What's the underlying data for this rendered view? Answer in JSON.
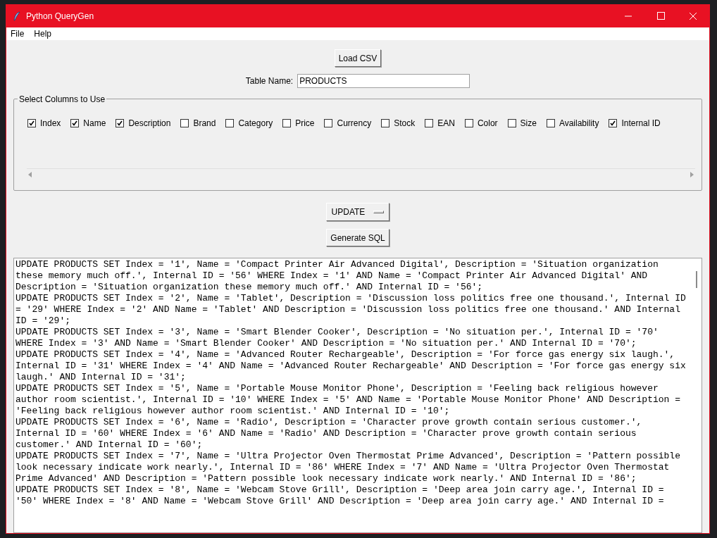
{
  "window": {
    "title": "Python QueryGen"
  },
  "menu": [
    "File",
    "Help"
  ],
  "load_button": "Load CSV",
  "table_name": {
    "label": "Table Name:",
    "value": "PRODUCTS"
  },
  "columns_frame": {
    "title": "Select Columns to Use",
    "columns": [
      {
        "label": "Index",
        "checked": true
      },
      {
        "label": "Name",
        "checked": true
      },
      {
        "label": "Description",
        "checked": true
      },
      {
        "label": "Brand",
        "checked": false
      },
      {
        "label": "Category",
        "checked": false
      },
      {
        "label": "Price",
        "checked": false
      },
      {
        "label": "Currency",
        "checked": false
      },
      {
        "label": "Stock",
        "checked": false
      },
      {
        "label": "EAN",
        "checked": false
      },
      {
        "label": "Color",
        "checked": false
      },
      {
        "label": "Size",
        "checked": false
      },
      {
        "label": "Availability",
        "checked": false
      },
      {
        "label": "Internal ID",
        "checked": true
      }
    ]
  },
  "query_type": "UPDATE",
  "generate_button": "Generate SQL",
  "output": [
    "UPDATE PRODUCTS SET Index = '1', Name = 'Compact Printer Air Advanced Digital', Description = 'Situation organization these memory much off.', Internal ID = '56' WHERE Index = '1' AND Name = 'Compact Printer Air Advanced Digital' AND Description = 'Situation organization these memory much off.' AND Internal ID = '56';",
    "UPDATE PRODUCTS SET Index = '2', Name = 'Tablet', Description = 'Discussion loss politics free one thousand.', Internal ID = '29' WHERE Index = '2' AND Name = 'Tablet' AND Description = 'Discussion loss politics free one thousand.' AND Internal ID = '29';",
    "UPDATE PRODUCTS SET Index = '3', Name = 'Smart Blender Cooker', Description = 'No situation per.', Internal ID = '70' WHERE Index = '3' AND Name = 'Smart Blender Cooker' AND Description = 'No situation per.' AND Internal ID = '70';",
    "UPDATE PRODUCTS SET Index = '4', Name = 'Advanced Router Rechargeable', Description = 'For force gas energy six laugh.', Internal ID = '31' WHERE Index = '4' AND Name = 'Advanced Router Rechargeable' AND Description = 'For force gas energy six laugh.' AND Internal ID = '31';",
    "UPDATE PRODUCTS SET Index = '5', Name = 'Portable Mouse Monitor Phone', Description = 'Feeling back religious however author room scientist.', Internal ID = '10' WHERE Index = '5' AND Name = 'Portable Mouse Monitor Phone' AND Description = 'Feeling back religious however author room scientist.' AND Internal ID = '10';",
    "UPDATE PRODUCTS SET Index = '6', Name = 'Radio', Description = 'Character prove growth contain serious customer.', Internal ID = '60' WHERE Index = '6' AND Name = 'Radio' AND Description = 'Character prove growth contain serious customer.' AND Internal ID = '60';",
    "UPDATE PRODUCTS SET Index = '7', Name = 'Ultra Projector Oven Thermostat Prime Advanced', Description = 'Pattern possible look necessary indicate work nearly.', Internal ID = '86' WHERE Index = '7' AND Name = 'Ultra Projector Oven Thermostat Prime Advanced' AND Description = 'Pattern possible look necessary indicate work nearly.' AND Internal ID = '86';",
    "UPDATE PRODUCTS SET Index = '8', Name = 'Webcam Stove Grill', Description = 'Deep area join carry age.', Internal ID = '50' WHERE Index = '8' AND Name = 'Webcam Stove Grill' AND Description = 'Deep area join carry age.' AND Internal ID ="
  ]
}
